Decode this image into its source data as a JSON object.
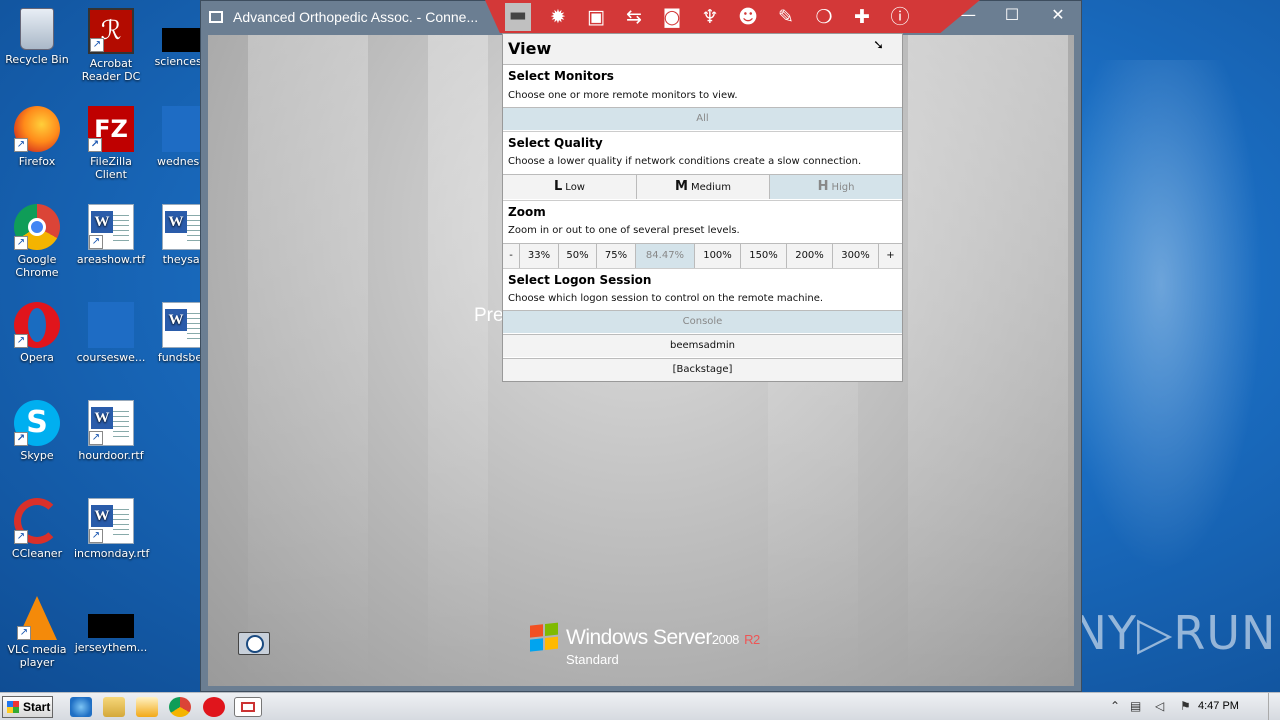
{
  "desktop_icons": [
    {
      "label": "Recycle Bin",
      "icon": "recycle-bin-icon"
    },
    {
      "label": "Acrobat Reader DC",
      "icon": "acrobat-icon"
    },
    {
      "label": "sciencesda",
      "icon": "black-thumbnail-icon"
    },
    {
      "label": "Firefox",
      "icon": "firefox-icon"
    },
    {
      "label": "FileZilla Client",
      "icon": "filezilla-icon"
    },
    {
      "label": "wednesda",
      "icon": "generic-file-icon"
    },
    {
      "label": "Google Chrome",
      "icon": "chrome-icon"
    },
    {
      "label": "areashow.rtf",
      "icon": "word-doc-icon"
    },
    {
      "label": "theysat.",
      "icon": "word-doc-icon"
    },
    {
      "label": "Opera",
      "icon": "opera-icon"
    },
    {
      "label": "courseswe...",
      "icon": "generic-file-icon"
    },
    {
      "label": "fundsbegi",
      "icon": "word-doc-icon"
    },
    {
      "label": "Skype",
      "icon": "skype-icon"
    },
    {
      "label": "hourdoor.rtf",
      "icon": "word-doc-icon"
    },
    {
      "label": "CCleaner",
      "icon": "ccleaner-icon"
    },
    {
      "label": "incmonday.rtf",
      "icon": "word-doc-icon"
    },
    {
      "label": "VLC media player",
      "icon": "vlc-icon"
    },
    {
      "label": "jerseythem...",
      "icon": "black-thumbnail-icon"
    }
  ],
  "window": {
    "title": "Advanced Orthopedic Assoc. - Conne...",
    "minimize": "—",
    "maximize": "☐",
    "close": "✕"
  },
  "remote": {
    "press_text": "Pre",
    "logo_name": "Windows Server",
    "logo_version": "2008",
    "logo_r2": "R2",
    "logo_edition": "Standard"
  },
  "toolbar": {
    "accent": "#d33838",
    "buttons": [
      {
        "icon": "monitor-icon",
        "glyph": "▬"
      },
      {
        "icon": "gear-icon",
        "glyph": "✹"
      },
      {
        "icon": "toolbox-icon",
        "glyph": "▣"
      },
      {
        "icon": "transfer-arrows-icon",
        "glyph": "⇆"
      },
      {
        "icon": "camera-icon",
        "glyph": "◙"
      },
      {
        "icon": "microphone-icon",
        "glyph": "♆"
      },
      {
        "icon": "users-icon",
        "glyph": "☻"
      },
      {
        "icon": "pencil-icon",
        "glyph": "✎"
      },
      {
        "icon": "chat-icon",
        "glyph": "❍"
      },
      {
        "icon": "plus-icon",
        "glyph": "✚"
      },
      {
        "icon": "info-icon",
        "glyph": "ⓘ"
      }
    ]
  },
  "view_panel": {
    "title": "View",
    "monitors": {
      "title": "Select Monitors",
      "desc": "Choose one or more remote monitors to view.",
      "option": "All"
    },
    "quality": {
      "title": "Select Quality",
      "desc": "Choose a lower quality if network conditions create a slow connection.",
      "options": [
        {
          "letter": "L",
          "label": "Low"
        },
        {
          "letter": "M",
          "label": "Medium"
        },
        {
          "letter": "H",
          "label": "High"
        }
      ]
    },
    "zoom": {
      "title": "Zoom",
      "desc": "Zoom in or out to one of several preset levels.",
      "minus": "-",
      "plus": "+",
      "levels": [
        "33%",
        "50%",
        "75%",
        "84.47%",
        "100%",
        "150%",
        "200%",
        "300%"
      ]
    },
    "logon": {
      "title": "Select Logon Session",
      "desc": "Choose which logon session to control on the remote machine.",
      "sessions": [
        "Console",
        "beemsadmin",
        "[Backstage]"
      ]
    }
  },
  "taskbar": {
    "start": "Start",
    "clock": "4:47 PM"
  },
  "watermark": "ANY▷RUN"
}
